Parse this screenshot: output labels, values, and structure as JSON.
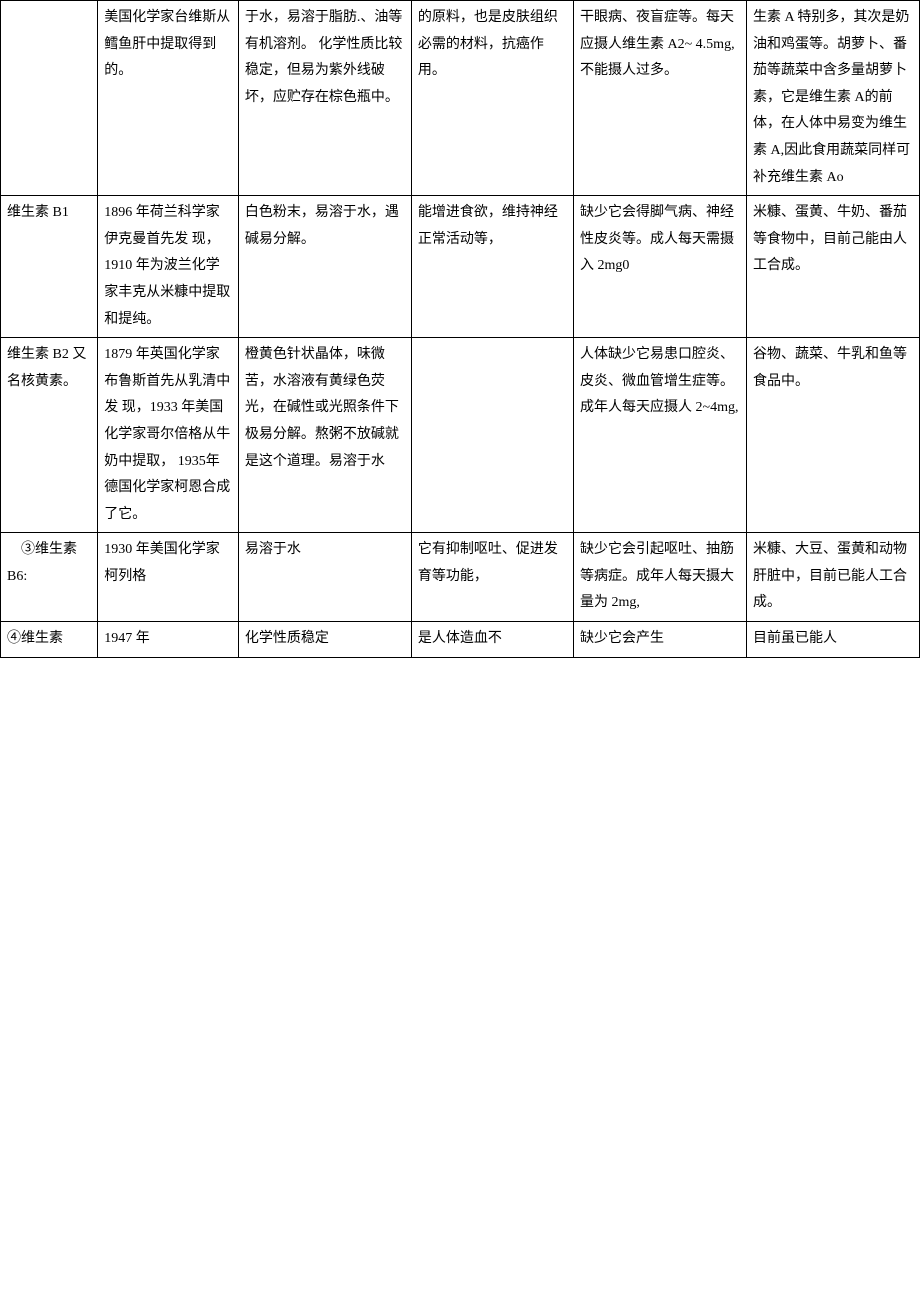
{
  "rows": [
    {
      "c1": "",
      "c2": "美国化学家台维斯从鳕鱼肝中提取得到的。",
      "c3": "于水，易溶于脂肪.、油等有机溶剂。\n化学性质比较稳定，但易为紫外线破坏，应贮存在棕色瓶中。",
      "c4": "的原料，也是皮肤组织必需的材料，抗癌作用。",
      "c5": "干眼病、夜盲症等。每天应摄人维生素 A2~\n4.5mg,不能摄人过多。",
      "c6": "生素 A 特别多，其次是奶油和鸡蛋等。胡萝卜、番茄等蔬菜中含多量胡萝卜素，它是维生素 A的前体，在人体中易变为维生素 A,因此食用蔬菜同样可补充维生素\nAo"
    },
    {
      "c1": "维生素\nB1",
      "c2": "1896 年荷兰科学家伊克曼首先发\n现，1910 年为波兰化学家丰克从米糠中提取和提纯。",
      "c3": "白色粉末，易溶于水，遇碱易分解。",
      "c4": "能增进食欲，维持神经正常活动等，",
      "c5": "缺少它会得脚气病、神经性皮炎等。成人每天需摄入 2mg0",
      "c6": "米糠、蛋黄、牛奶、番茄等食物中，目前己能由人工合成。"
    },
    {
      "c1": "维生素\nB2\n又名核黄素。",
      "c2": "1879 年英国化学家布鲁斯首先从乳清中发\n现，1933 年美国化学家哥尔倍格从牛奶中提取， 1935年德国化学家柯恩合成了它。",
      "c3": "橙黄色针状晶体，味微苦，水溶液有黄绿色荧光，在碱性或光照条件下极易分解。熬粥不放碱就是这个道理。易溶于水",
      "c4": "",
      "c5": "人体缺少它易患口腔炎、皮炎、微血管增生症等。成年人每天应摄人 2~4mg,",
      "c6": "谷物、蔬菜、牛乳和鱼等食品中。"
    },
    {
      "c1": "　③维生素 B6:",
      "c2": "1930 年美国化学家柯列格",
      "c3": "易溶于水",
      "c4": "它有抑制呕吐、促进发育等功能，",
      "c5": "缺少它会引起呕吐、抽筋等病症。成年人每天摄大量为 2mg,",
      "c6": "米糠、大豆、蛋黄和动物肝脏中，目前已能人工合成。"
    },
    {
      "c1": "④维生素",
      "c2": "1947 年",
      "c3": "化学性质稳定",
      "c4": "是人体造血不",
      "c5": "缺少它会产生",
      "c6": "目前虽已能人"
    }
  ]
}
